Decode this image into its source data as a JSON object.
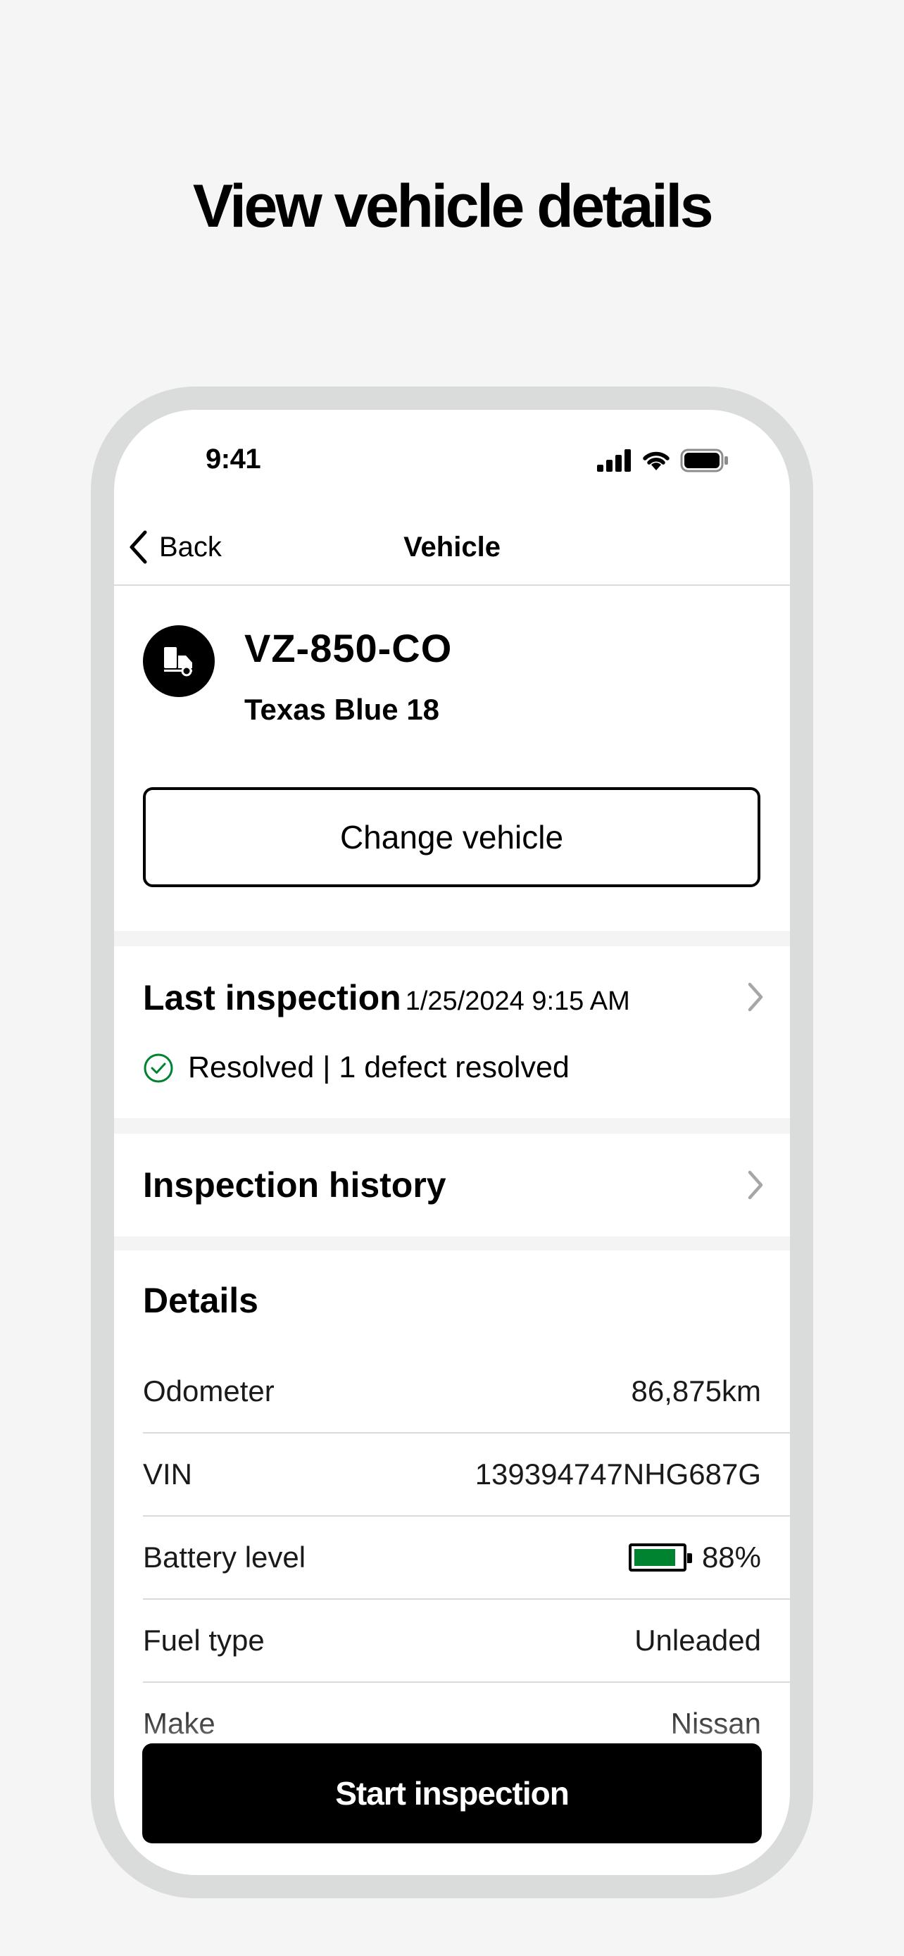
{
  "heading": "View vehicle details",
  "status_bar": {
    "time": "9:41",
    "icons": [
      "cellular-signal-icon",
      "wifi-icon",
      "battery-icon"
    ]
  },
  "nav": {
    "back_label": "Back",
    "title": "Vehicle"
  },
  "vehicle": {
    "id": "VZ-850-CO",
    "name": "Texas Blue 18",
    "icon": "truck-icon",
    "change_label": "Change vehicle"
  },
  "last_inspection": {
    "title": "Last inspection",
    "datetime": "1/25/2024 9:15 AM",
    "status": "Resolved | 1 defect resolved",
    "status_color": "#008331"
  },
  "inspection_history": {
    "label": "Inspection history"
  },
  "details": {
    "heading": "Details",
    "rows": [
      {
        "label": "Odometer",
        "value": "86,875km"
      },
      {
        "label": "VIN",
        "value": "139394747NHG687G"
      },
      {
        "label": "Battery level",
        "value": "88%",
        "battery_fraction": 0.88,
        "battery_color": "#008331"
      },
      {
        "label": "Fuel type",
        "value": "Unleaded"
      },
      {
        "label": "Make",
        "value": "Nissan"
      }
    ]
  },
  "primary_action": {
    "label": "Start inspection"
  }
}
